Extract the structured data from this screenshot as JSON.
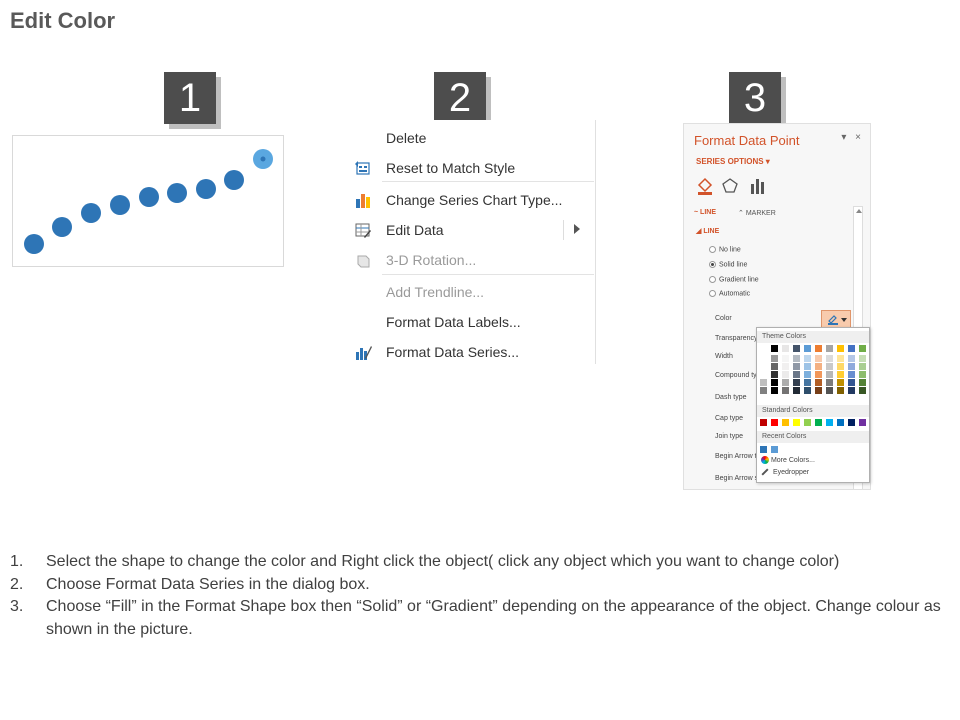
{
  "title": "Edit Color",
  "steps": [
    "1",
    "2",
    "3"
  ],
  "context_menu": {
    "items": [
      {
        "label": "Delete",
        "disabled": false
      },
      {
        "label": "Reset to Match Style",
        "disabled": false
      },
      {
        "label": "Change Series Chart Type...",
        "disabled": false
      },
      {
        "label": "Edit Data",
        "disabled": false
      },
      {
        "label": "3-D Rotation...",
        "disabled": true
      },
      {
        "label": "Add Trendline...",
        "disabled": true
      },
      {
        "label": "Format Data Labels...",
        "disabled": false
      },
      {
        "label": "Format Data Series...",
        "disabled": false
      }
    ]
  },
  "format_pane": {
    "title": "Format Data Point",
    "series_options": "SERIES OPTIONS",
    "tab_line": "LINE",
    "tab_marker": "MARKER",
    "section": "LINE",
    "radios": [
      "No line",
      "Solid line",
      "Gradient line",
      "Automatic"
    ],
    "selected_radio": "Solid line",
    "props": [
      "Color",
      "Transparency",
      "Width",
      "Compound type",
      "Dash type",
      "Cap type",
      "Join type",
      "Begin Arrow type",
      "Begin Arrow size"
    ],
    "palette": {
      "theme_header": "Theme Colors",
      "standard_header": "Standard Colors",
      "recent_header": "Recent Colors",
      "more_colors": "More Colors...",
      "eyedropper": "Eyedropper",
      "theme_top_row": [
        "#ffffff",
        "#000000",
        "#e7e6e6",
        "#44546a",
        "#5b9bd5",
        "#ed7d31",
        "#a5a5a5",
        "#ffc000",
        "#4472c4",
        "#70ad47"
      ],
      "standard": [
        "#c00000",
        "#ff0000",
        "#ffc000",
        "#ffff00",
        "#92d050",
        "#00b050",
        "#00b0f0",
        "#0070c0",
        "#002060",
        "#7030a0"
      ],
      "recent": [
        "#2e75b6",
        "#5b9bd5"
      ]
    }
  },
  "chart_colors": {
    "marker": "#2e75b6",
    "selected_marker": "#5aa7e0"
  },
  "instructions": [
    {
      "num": "1.",
      "text": "Select the shape to change the color and Right click the object( click any object which you want to change color)"
    },
    {
      "num": "2.",
      "text": "Choose Format Data Series in the dialog box."
    },
    {
      "num": "3.",
      "text": "Choose “Fill” in the Format Shape box then “Solid” or “Gradient” depending on the appearance of the object. Change colour as shown in the picture."
    }
  ]
}
